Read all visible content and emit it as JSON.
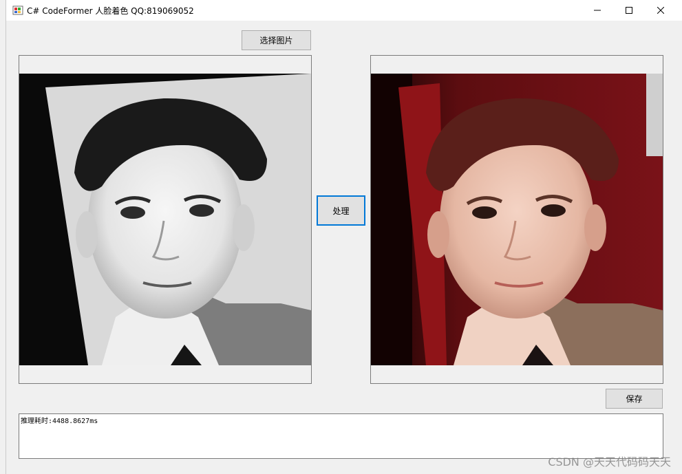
{
  "window": {
    "title": "C# CodeFormer 人脸着色 QQ:819069052"
  },
  "toolbar": {
    "select_image_label": "选择图片",
    "process_label": "处理",
    "save_label": "保存"
  },
  "images": {
    "source_desc": "grayscale portrait of a boy",
    "result_desc": "colorized portrait of the same boy"
  },
  "log": {
    "text": "推理耗时:4488.8627ms"
  },
  "watermark": {
    "text": "CSDN @天天代码码天天"
  },
  "colors": {
    "focus_border": "#0078d7",
    "button_bg": "#e1e1e1",
    "window_bg": "#f0f0f0"
  }
}
